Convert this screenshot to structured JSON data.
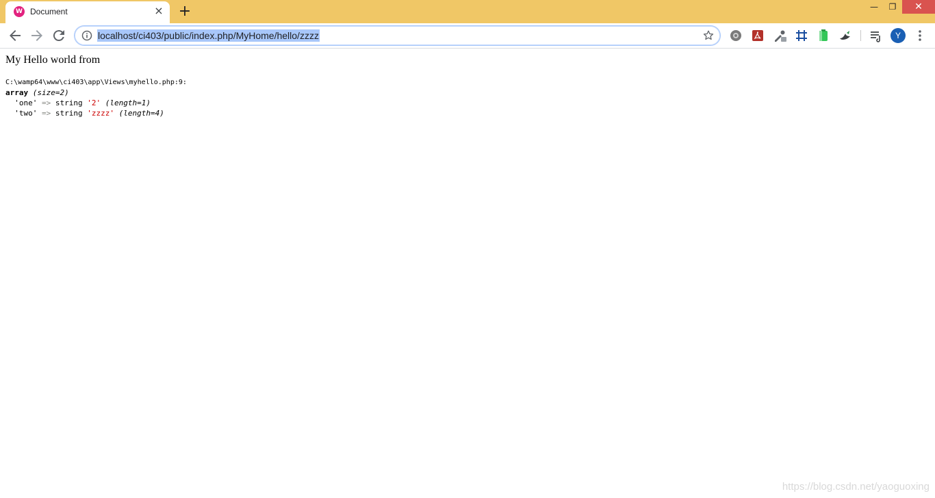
{
  "browser": {
    "tab_title": "Document",
    "favicon_letter": "W",
    "url": "localhost/ci403/public/index.php/MyHome/hello/zzzz",
    "avatar_letter": "Y",
    "accent": "#f0c766"
  },
  "page": {
    "heading": "My Hello world from",
    "dump": {
      "path": "C:\\wamp64\\www\\ci403\\app\\Views\\myhello.php:9:",
      "array_kw": "array",
      "array_meta": "(size=2)",
      "rows": [
        {
          "key": "'one'",
          "arrow": "=>",
          "type": "string",
          "value": "'2'",
          "meta": "(length=1)"
        },
        {
          "key": "'two'",
          "arrow": "=>",
          "type": "string",
          "value": "'zzzz'",
          "meta": "(length=4)"
        }
      ]
    },
    "watermark": "https://blog.csdn.net/yaoguoxing"
  },
  "icons": [
    "back-arrow-icon",
    "forward-arrow-icon",
    "reload-icon",
    "info-icon",
    "star-icon",
    "extension-icon",
    "kebab-menu-icon",
    "close-icon",
    "plus-icon"
  ]
}
